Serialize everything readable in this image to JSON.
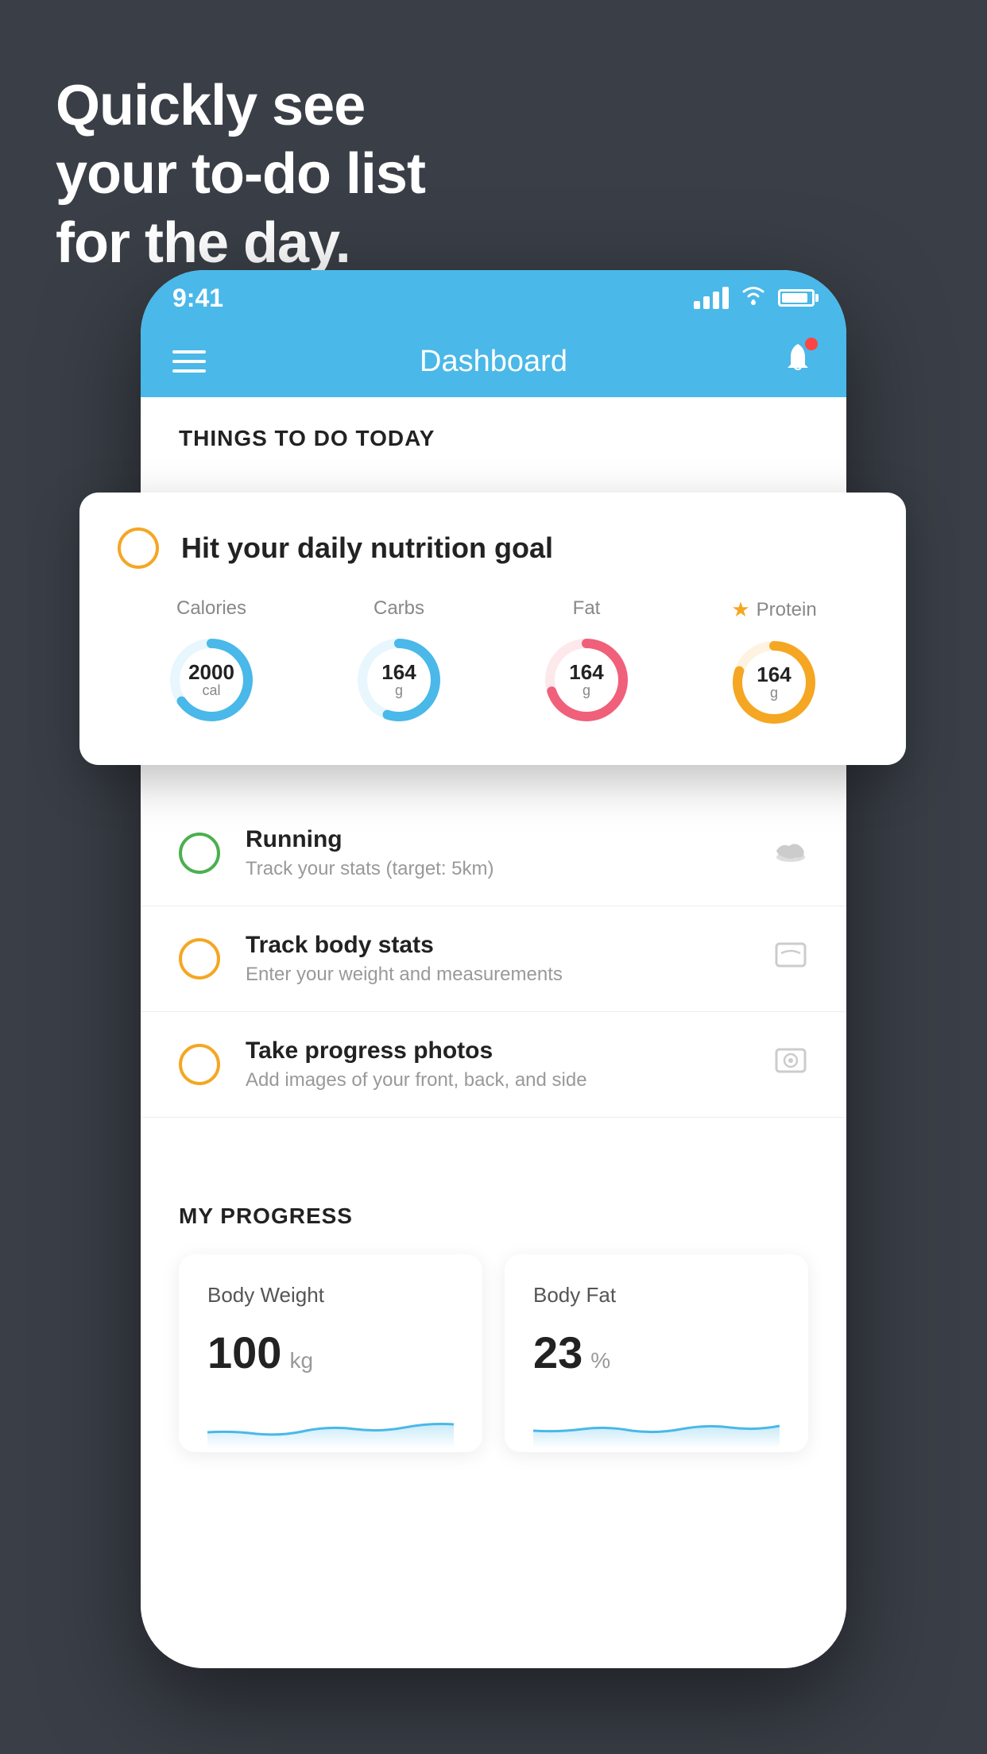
{
  "headline": {
    "line1": "Quickly see",
    "line2": "your to-do list",
    "line3": "for the day."
  },
  "status_bar": {
    "time": "9:41"
  },
  "nav": {
    "title": "Dashboard"
  },
  "things_section": {
    "header": "THINGS TO DO TODAY"
  },
  "nutrition_card": {
    "title": "Hit your daily nutrition goal",
    "macros": [
      {
        "label": "Calories",
        "value": "2000",
        "unit": "cal",
        "color": "#4ab8e8",
        "percent": 65,
        "starred": false
      },
      {
        "label": "Carbs",
        "value": "164",
        "unit": "g",
        "color": "#4ab8e8",
        "percent": 55,
        "starred": false
      },
      {
        "label": "Fat",
        "value": "164",
        "unit": "g",
        "color": "#f0607a",
        "percent": 70,
        "starred": false
      },
      {
        "label": "Protein",
        "value": "164",
        "unit": "g",
        "color": "#f5a623",
        "percent": 80,
        "starred": true
      }
    ]
  },
  "todo_items": [
    {
      "main": "Running",
      "sub": "Track your stats (target: 5km)",
      "circle_color": "green",
      "icon": "👟"
    },
    {
      "main": "Track body stats",
      "sub": "Enter your weight and measurements",
      "circle_color": "yellow",
      "icon": "⚖️"
    },
    {
      "main": "Take progress photos",
      "sub": "Add images of your front, back, and side",
      "circle_color": "yellow",
      "icon": "🖼️"
    }
  ],
  "progress": {
    "header": "MY PROGRESS",
    "cards": [
      {
        "title": "Body Weight",
        "value": "100",
        "unit": "kg"
      },
      {
        "title": "Body Fat",
        "value": "23",
        "unit": "%"
      }
    ]
  }
}
